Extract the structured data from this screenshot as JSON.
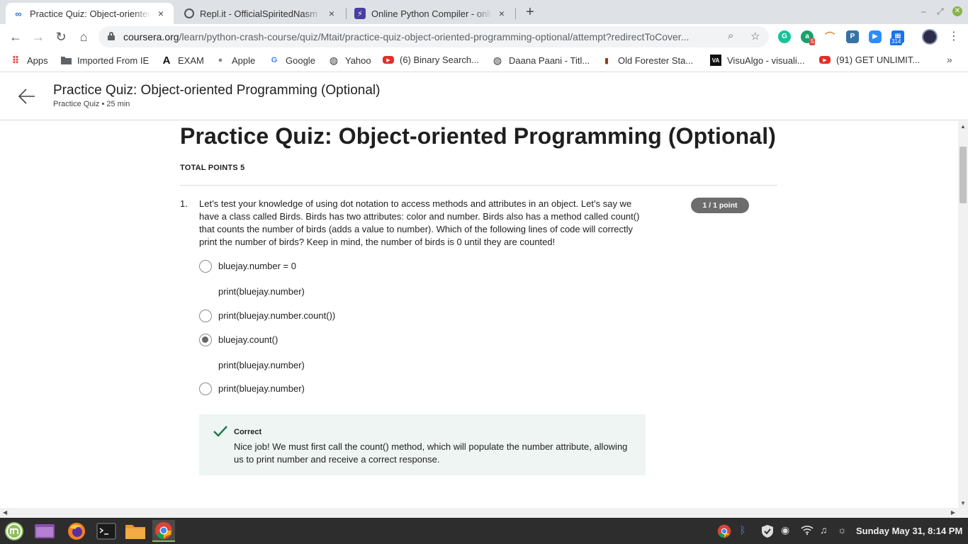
{
  "browser": {
    "tabs": [
      {
        "title": "Practice Quiz: Object-oriented",
        "close": "×"
      },
      {
        "title": "Repl.it - OfficialSpiritedNasm",
        "close": "×"
      },
      {
        "title": "Online Python Compiler - online",
        "close": "×"
      }
    ],
    "new_tab": "+",
    "url_domain": "coursera.org",
    "url_path": "/learn/python-crash-course/quiz/Mtait/practice-quiz-object-oriented-programming-optional/attempt?redirectToCover...",
    "extension_badges": {
      "grammarly": "5",
      "calendar": "314"
    },
    "bookmarks": [
      {
        "label": "Apps"
      },
      {
        "label": "Imported From IE"
      },
      {
        "label": "EXAM"
      },
      {
        "label": "Apple"
      },
      {
        "label": "Google"
      },
      {
        "label": "Yahoo"
      },
      {
        "label": "(6) Binary Search..."
      },
      {
        "label": "Daana Paani - Titl..."
      },
      {
        "label": "Old Forester Sta..."
      },
      {
        "label": "VisuAlgo - visuali..."
      },
      {
        "label": "(91) GET UNLIMIT..."
      }
    ],
    "bookmarks_more": "»"
  },
  "header": {
    "title": "Practice Quiz: Object-oriented Programming (Optional)",
    "subtitle": "Practice Quiz • 25 min"
  },
  "quiz": {
    "title": "Practice Quiz: Object-oriented Programming (Optional)",
    "total_points": "TOTAL POINTS 5",
    "question": {
      "number": "1.",
      "text": "Let’s test your knowledge of using dot notation to access methods and attributes in an object. Let’s say we have a class called Birds. Birds has two attributes: color and number. Birds also has a method called count() that counts the number of birds (adds a value to number). Which of the following lines of code will correctly print the number of birds? Keep in mind, the number of birds is 0 until they are counted!",
      "points": "1 / 1 point",
      "options": [
        {
          "lines": [
            "bluejay.number = 0",
            "print(bluejay.number)"
          ],
          "selected": false
        },
        {
          "lines": [
            "print(bluejay.number.count())"
          ],
          "selected": false
        },
        {
          "lines": [
            "bluejay.count()",
            "print(bluejay.number)"
          ],
          "selected": true
        },
        {
          "lines": [
            "print(bluejay.number)"
          ],
          "selected": false
        }
      ],
      "feedback": {
        "title": "Correct",
        "text": "Nice job! We must first call the count() method, which will populate the number attribute, allowing us to print number and receive a correct response."
      }
    }
  },
  "taskbar": {
    "clock": "Sunday May 31,  8:14 PM"
  },
  "colors": {
    "correct_green": "#1d7a4c",
    "badge_gray": "#6d6d6d",
    "feedback_bg": "#eef5f3"
  }
}
